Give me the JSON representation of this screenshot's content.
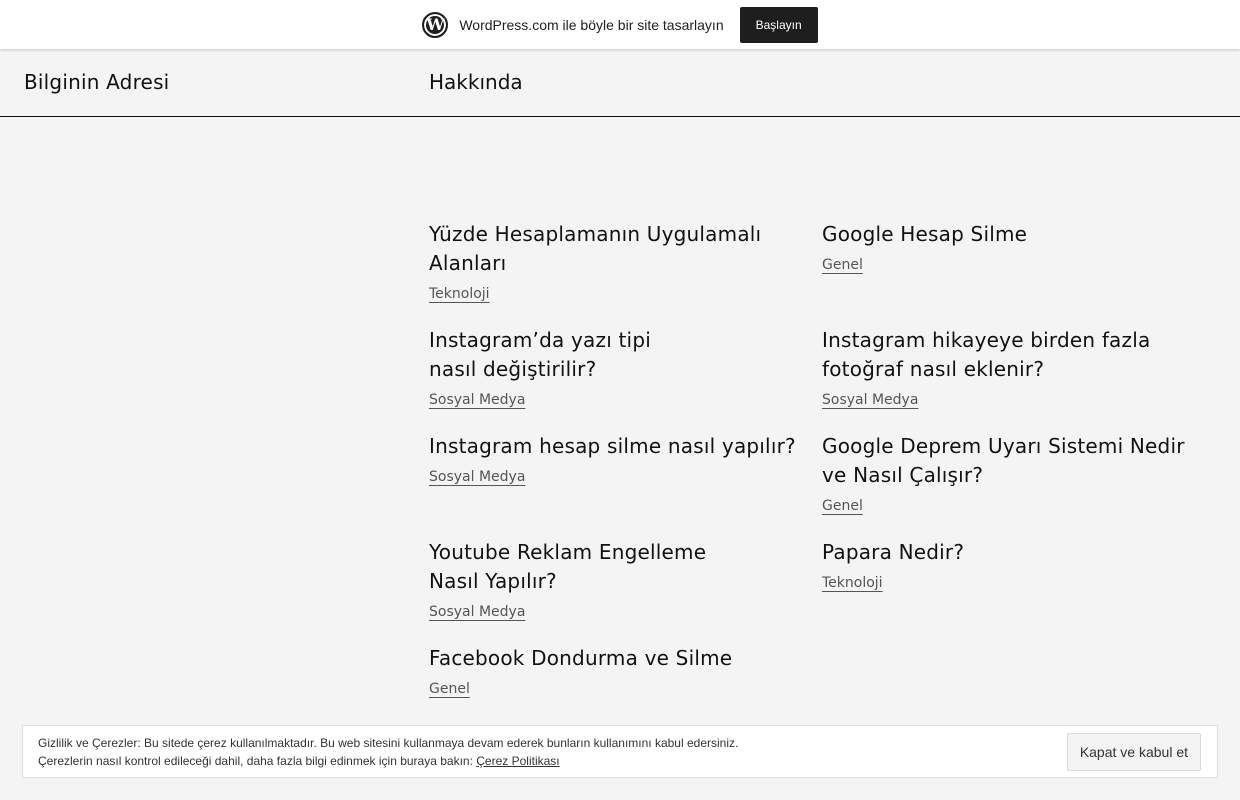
{
  "wp_bar": {
    "logo_glyph": "W",
    "text": "WordPress.com ile böyle bir site tasarlayın",
    "button_label": "Başlayın"
  },
  "header": {
    "site_title": "Bilginin Adresi",
    "nav_about": "Hakkında"
  },
  "posts": [
    {
      "title": "Yüzde Hesaplamanın Uygulamalı Alanları",
      "category": "Teknoloji"
    },
    {
      "title": "Google Hesap Silme",
      "category": "Genel"
    },
    {
      "title": "Instagram’da yazı tipi nasıl değiştirilir?",
      "category": "Sosyal Medya"
    },
    {
      "title": "Instagram hikayeye birden fazla fotoğraf nasıl eklenir?",
      "category": "Sosyal Medya"
    },
    {
      "title": "Instagram hesap silme nasıl yapılır?",
      "category": "Sosyal Medya"
    },
    {
      "title": "Google Deprem Uyarı Sistemi Nedir ve Nasıl Çalışır?",
      "category": "Genel"
    },
    {
      "title": "Youtube Reklam Engelleme Nasıl Yapılır?",
      "category": "Sosyal Medya"
    },
    {
      "title": "Papara Nedir?",
      "category": "Teknoloji"
    },
    {
      "title": "Facebook Dondurma ve Silme",
      "category": "Genel"
    }
  ],
  "cookie": {
    "line1": "Gizlilik ve Çerezler: Bu sitede çerez kullanılmaktadır. Bu web sitesini kullanmaya devam ederek bunların kullanımını kabul edersiniz.",
    "line2": "Çerezlerin nasıl kontrol edileceği dahil, daha fazla bilgi edinmek için buraya bakın:",
    "policy_link": "Çerez Politikası",
    "accept_button": "Kapat ve kabul et"
  }
}
